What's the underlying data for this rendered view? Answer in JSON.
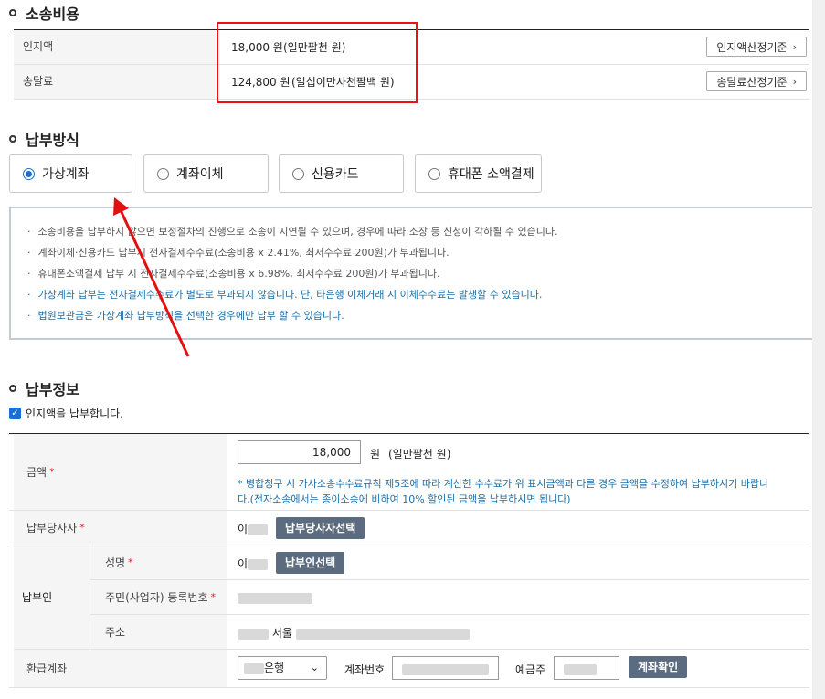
{
  "cost": {
    "title": "소송비용",
    "rows": [
      {
        "label": "인지액",
        "amount": "18,000 원",
        "korean": "(일만팔천 원)",
        "button": "인지액산정기준"
      },
      {
        "label": "송달료",
        "amount": "124,800 원",
        "korean": "(일십이만사천팔백 원)",
        "button": "송달료산정기준"
      }
    ]
  },
  "payment_method": {
    "title": "납부방식",
    "options": [
      "가상계좌",
      "계좌이체",
      "신용카드",
      "휴대폰 소액결제"
    ],
    "selected": "가상계좌"
  },
  "notices": [
    "소송비용을 납부하지 않으면 보정절차의 진행으로 소송이 지연될 수 있으며, 경우에 따라 소장 등 신청이 각하될 수 있습니다.",
    "계좌이체·신용카드 납부시 전자결제수수료(소송비용 x 2.41%, 최저수수료 200원)가 부과됩니다.",
    "휴대폰소액결제 납부 시 전자결제수수료(소송비용 x 6.98%, 최저수수료 200원)가 부과됩니다.",
    "가상계좌 납부는 전자결제수수료가 별도로 부과되지 않습니다. 단, 타은행 이체거래 시 이체수수료는 발생할 수 있습니다.",
    "법원보관금은 가상계좌 납부방식을 선택한 경우에만 납부 할 수 있습니다."
  ],
  "payment_info": {
    "title": "납부정보",
    "checkbox_label": "인지액을 납부합니다.",
    "amount_label": "금액",
    "amount_value": "18,000",
    "amount_unit": "원",
    "amount_korean": "(일만팔천 원)",
    "amount_note_1": "* 병합청구 시 가사소송수수료규칙 제5조에 따라 계산한 수수료가 위 표시금액과 다른 경우 금액을 수정하여 납부하시기 바랍니",
    "amount_note_2": "다.(전자소송에서는 종이소송에 비하여 10% 할인된 금액을 납부하시면 됩니다)",
    "party_label": "납부당사자",
    "party_value": "이",
    "party_button": "납부당사자선택",
    "payer_label": "납부인",
    "name_label": "성명",
    "name_value": "이",
    "name_button": "납부인선택",
    "id_label": "주민(사업자) 등록번호",
    "address_label": "주소",
    "address_value": "서울",
    "refund_label": "환급계좌",
    "bank_value": "은행",
    "account_label": "계좌번호",
    "holder_label": "예금주",
    "verify_button": "계좌확인"
  },
  "colors": {
    "highlight_box": "#e11111",
    "primary_blue": "#1a6fd6",
    "note_blue": "#1b6fa8",
    "button_dark": "#5b6b80"
  }
}
